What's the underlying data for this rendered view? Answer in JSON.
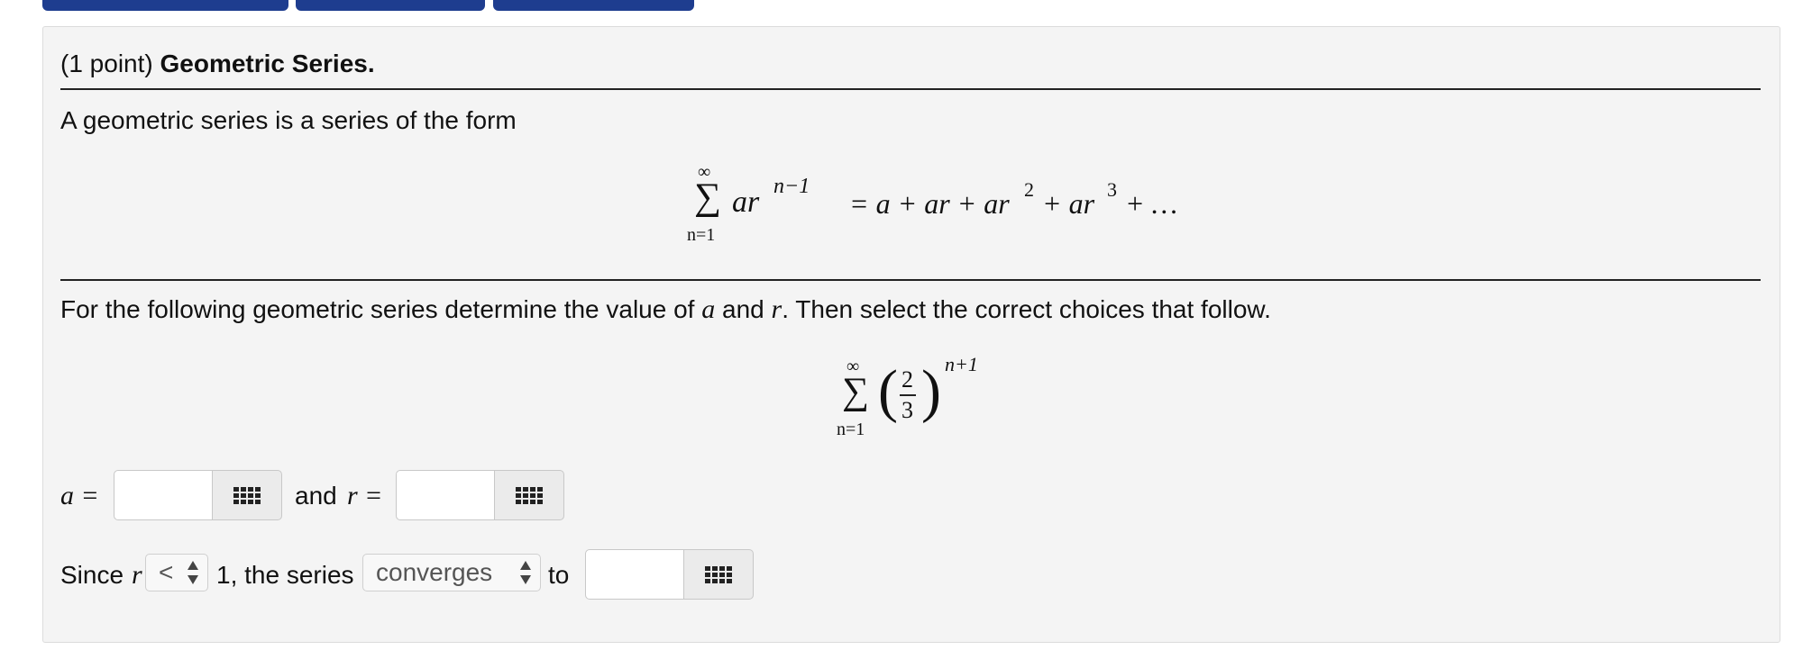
{
  "problem": {
    "points": "(1 point)",
    "title": "Geometric Series.",
    "intro": "A geometric series is a series of the form",
    "formula": {
      "sum_top": "∞",
      "sum_bottom": "n=1",
      "term_base": "ar",
      "term_exp": "n−1",
      "rhs_eq": "= a + ar + ar",
      "rhs_exp2": "2",
      "rhs_plus": " + ar",
      "rhs_exp3": "3",
      "rhs_tail": " + …"
    },
    "instruction_before": "For the following geometric series determine the value of ",
    "instruction_a": "a",
    "instruction_and": " and ",
    "instruction_r": "r",
    "instruction_after": ". Then select the correct choices that follow.",
    "series": {
      "sum_top": "∞",
      "sum_bottom": "n=1",
      "numerator": "2",
      "denominator": "3",
      "exponent": "n+1"
    }
  },
  "answers": {
    "a_label": "a =",
    "and_label": "and",
    "r_label": "r =",
    "a_value": "",
    "r_value": "",
    "since_label": "Since",
    "since_var": "r",
    "compare_selected": "<",
    "one_text": "1, the series",
    "behavior_selected": "converges",
    "to_label": "to",
    "sum_value": ""
  },
  "colors": {
    "panel_bg": "#f4f4f4",
    "top_button": "#1e3d8f"
  }
}
